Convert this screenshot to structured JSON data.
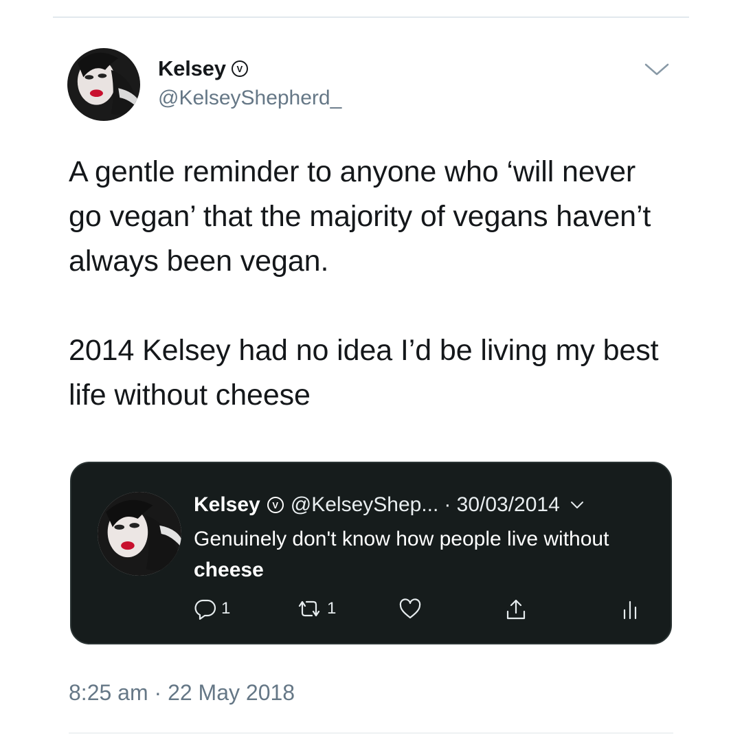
{
  "tweet": {
    "author_name": "Kelsey",
    "author_handle": "@KelseyShepherd_",
    "text_paragraph_1": "A gentle reminder to anyone who ‘will never go vegan’ that the majority of vegans haven’t always been vegan.",
    "text_paragraph_2": "2014 Kelsey had no idea I’d be living my best life without cheese",
    "timestamp": "8:25 am · 22 May 2018"
  },
  "quoted_tweet": {
    "author_name": "Kelsey",
    "author_handle": "@KelseyShep...",
    "date": "· 30/03/2014",
    "text_plain": "Genuinely don't know how people live without",
    "text_bold": "cheese",
    "reply_count": "1",
    "retweet_count": "1"
  },
  "icons": {
    "verified": "verified-badge-icon",
    "caret": "chevron-down-icon",
    "reply": "reply-icon",
    "retweet": "retweet-icon",
    "like": "like-heart-icon",
    "share": "share-icon",
    "analytics": "analytics-icon"
  },
  "colors": {
    "text": "#14171a",
    "secondary_text": "#657786",
    "quote_background": "#161c1c",
    "quote_text": "#ffffff",
    "avatar_lips": "#c8102e"
  }
}
